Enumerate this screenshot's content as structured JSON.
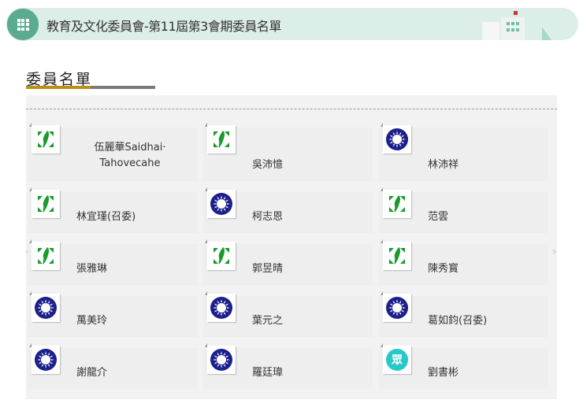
{
  "header": {
    "title": "教育及文化委員會-第11屆第3會期委員名單"
  },
  "section_title": "委員名單",
  "colors": {
    "dpp": "#1a9a2e",
    "kmt": "#1b1f8c",
    "tpp": "#28c8c8",
    "accent": "#b8901a"
  },
  "members": [
    {
      "name": "伍麗華Saidhai·Tahovecahe",
      "party": "dpp"
    },
    {
      "name": "吳沛憶",
      "party": "dpp"
    },
    {
      "name": "林沛祥",
      "party": "kmt"
    },
    {
      "name": "林宜瑾(召委)",
      "party": "dpp"
    },
    {
      "name": "柯志恩",
      "party": "kmt"
    },
    {
      "name": "范雲",
      "party": "dpp"
    },
    {
      "name": "張雅琳",
      "party": "dpp"
    },
    {
      "name": "郭昱晴",
      "party": "dpp"
    },
    {
      "name": "陳秀寳",
      "party": "dpp"
    },
    {
      "name": "萬美玲",
      "party": "kmt"
    },
    {
      "name": "葉元之",
      "party": "kmt"
    },
    {
      "name": "葛如鈞(召委)",
      "party": "kmt"
    },
    {
      "name": "謝龍介",
      "party": "kmt"
    },
    {
      "name": "羅廷瑋",
      "party": "kmt"
    },
    {
      "name": "劉書彬",
      "party": "tpp"
    }
  ],
  "tpp_logo_text": "眾"
}
